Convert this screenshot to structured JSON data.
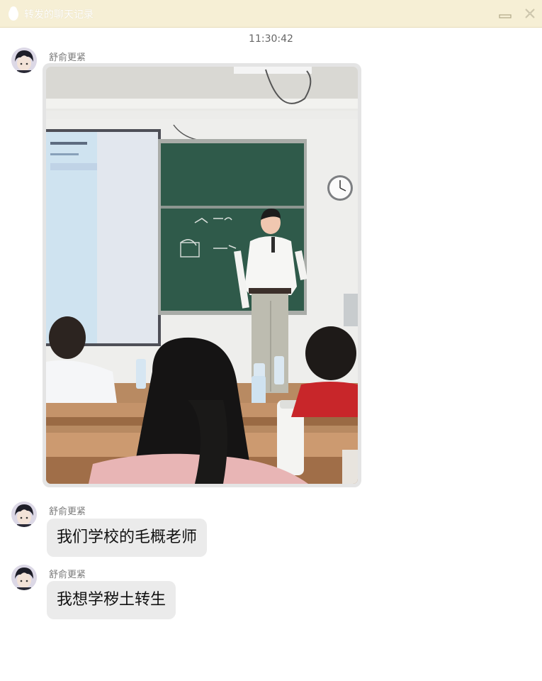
{
  "window": {
    "title": "转发的聊天记录"
  },
  "chat": {
    "timestamp": "11:30:42",
    "messages": [
      {
        "sender": "舒俞更紧",
        "type": "image"
      },
      {
        "sender": "舒俞更紧",
        "type": "text",
        "text": "我们学校的毛概老师"
      },
      {
        "sender": "舒俞更紧",
        "type": "text",
        "text": "我想学秽土转生"
      }
    ]
  },
  "icons": {
    "app": "penguin-icon",
    "minimize": "minimize-icon",
    "close": "close-icon",
    "avatar": "anime-boy-avatar"
  },
  "colors": {
    "titlebar_bg": "#f6efd5",
    "bubble_bg": "#ebebeb"
  }
}
